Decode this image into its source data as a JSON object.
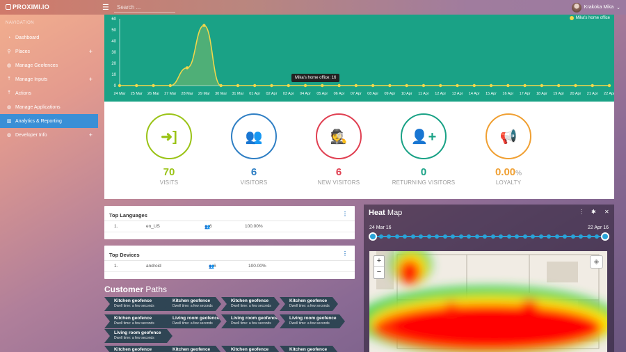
{
  "brand": "PROXIMI.IO",
  "search": {
    "placeholder": "Search ..."
  },
  "user": {
    "name": "Krakoka Mika"
  },
  "sidebar": {
    "heading": "NAVIGATION",
    "items": [
      {
        "label": "Dashboard",
        "icon": "dashboard-icon"
      },
      {
        "label": "Places",
        "icon": "map-pin-icon",
        "plus": "+"
      },
      {
        "label": "Manage Geofences",
        "icon": "globe-icon"
      },
      {
        "label": "Manage Inputs",
        "icon": "upload-icon",
        "plus": "+"
      },
      {
        "label": "Actions",
        "icon": "upload-icon"
      },
      {
        "label": "Manage Applications",
        "icon": "globe-icon"
      },
      {
        "label": "Analytics & Reporting",
        "icon": "bar-chart-icon",
        "active": true
      },
      {
        "label": "Developer Info",
        "icon": "globe-icon",
        "plus": "+"
      }
    ]
  },
  "chart_data": {
    "type": "line",
    "x": [
      "24 Mar",
      "25 Mar",
      "26 Mar",
      "27 Mar",
      "28 Mar",
      "29 Mar",
      "30 Mar",
      "31 Mar",
      "01 Apr",
      "02 Apr",
      "03 Apr",
      "04 Apr",
      "05 Apr",
      "06 Apr",
      "07 Apr",
      "08 Apr",
      "09 Apr",
      "10 Apr",
      "11 Apr",
      "12 Apr",
      "13 Apr",
      "14 Apr",
      "15 Apr",
      "16 Apr",
      "17 Apr",
      "18 Apr",
      "19 Apr",
      "20 Apr",
      "21 Apr",
      "22 Apr"
    ],
    "series": [
      {
        "name": "Mika's home office",
        "color": "#f1d74b",
        "values": [
          0,
          0,
          0,
          0,
          16,
          54,
          0,
          0,
          0,
          0,
          0,
          0,
          0,
          0,
          0,
          0,
          0,
          0,
          0,
          0,
          0,
          0,
          0,
          0,
          0,
          0,
          0,
          0,
          0,
          0
        ]
      }
    ],
    "yticks": [
      0,
      10,
      20,
      30,
      40,
      50,
      60
    ],
    "ylim": [
      0,
      60
    ],
    "tooltip": "Mika's home office: 16"
  },
  "stats": [
    {
      "value": "70",
      "label": "VISITS",
      "color": "#9ac316",
      "icon": "sign-in-icon"
    },
    {
      "value": "6",
      "label": "VISITORS",
      "color": "#2f7fc4",
      "icon": "users-icon"
    },
    {
      "value": "6",
      "label": "NEW VISITORS",
      "color": "#e04052",
      "icon": "spy-icon"
    },
    {
      "value": "0",
      "label": "RETURNING VISITORS",
      "color": "#1aa286",
      "icon": "user-plus-icon"
    },
    {
      "value": "0.00",
      "unit": "%",
      "label": "LOYALTY",
      "color": "#f0a033",
      "icon": "bullhorn-icon"
    }
  ],
  "languages": {
    "title": "Top Languages",
    "rows": [
      {
        "rank": "1.",
        "name": "en_US",
        "count": "6",
        "pct": "100.00%"
      }
    ]
  },
  "devices": {
    "title": "Top Devices",
    "rows": [
      {
        "rank": "1.",
        "name": "android",
        "count": "6",
        "pct": "100.00%"
      }
    ]
  },
  "customer_paths": {
    "title_bold": "Customer",
    "title_rest": " Paths",
    "dwell": "Dwell time: a few seconds",
    "rows": [
      [
        "Kitchen geofence",
        "Kitchen geofence",
        "Kitchen geofence",
        "Kitchen geofence"
      ],
      [
        "Kitchen geofence",
        "Living room geofence",
        "Living room geofence",
        "Living room geofence"
      ],
      [
        "Living room geofence"
      ],
      [
        "Kitchen geofence",
        "Kitchen geofence",
        "Kitchen geofence",
        "Kitchen geofence"
      ]
    ]
  },
  "heatmap": {
    "title_bold": "Heat",
    "title_rest": " Map",
    "start": "24 Mar 16",
    "end": "22 Apr 16",
    "zoom_in": "+",
    "zoom_out": "−"
  }
}
